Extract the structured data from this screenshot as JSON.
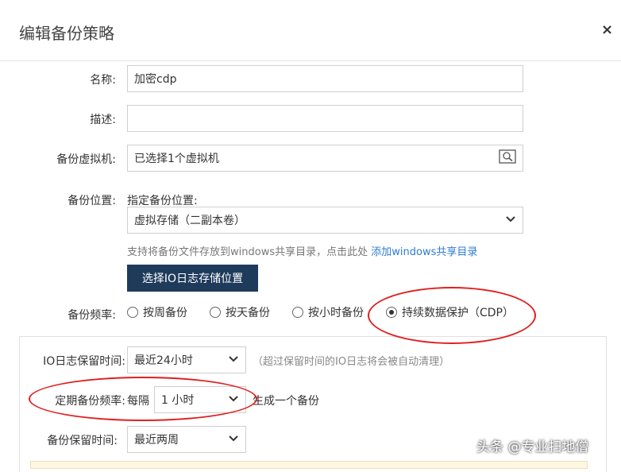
{
  "dialog": {
    "title": "编辑备份策略",
    "close_icon": "×"
  },
  "form": {
    "name": {
      "label": "名称:",
      "value": "加密cdp"
    },
    "description": {
      "label": "描述:",
      "value": ""
    },
    "vm": {
      "label": "备份虚拟机:",
      "value": "已选择1个虚拟机",
      "icon": "search-icon"
    },
    "location": {
      "label": "备份位置:",
      "sublabel": "指定备份位置:",
      "selected": "虚拟存储（二副本卷）",
      "hint": "支持将备份文件存放到windows共享目录，点击此处",
      "hint_link": "添加windows共享目录",
      "io_button": "选择IO日志存储位置"
    },
    "frequency": {
      "label": "备份频率:",
      "options": [
        {
          "label": "按周备份",
          "checked": false
        },
        {
          "label": "按天备份",
          "checked": false
        },
        {
          "label": "按小时备份",
          "checked": false
        },
        {
          "label": "持续数据保护（CDP）",
          "checked": true
        }
      ]
    }
  },
  "cdp": {
    "io_retention": {
      "label": "IO日志保留时间:",
      "selected": "最近24小时",
      "hint": "（超过保留时间的IO日志将会被自动清理）"
    },
    "periodic": {
      "label": "定期备份频率:",
      "prefix": "每隔",
      "selected": "1 小时",
      "suffix": "生成一个备份"
    },
    "backup_retention": {
      "label": "备份保留时间:",
      "selected": "最近两周"
    }
  },
  "watermark": "头条 @专业扫地僧",
  "colors": {
    "annotation": "#e02020",
    "button_dark": "#1f3b5c",
    "link": "#2f7bd4"
  }
}
